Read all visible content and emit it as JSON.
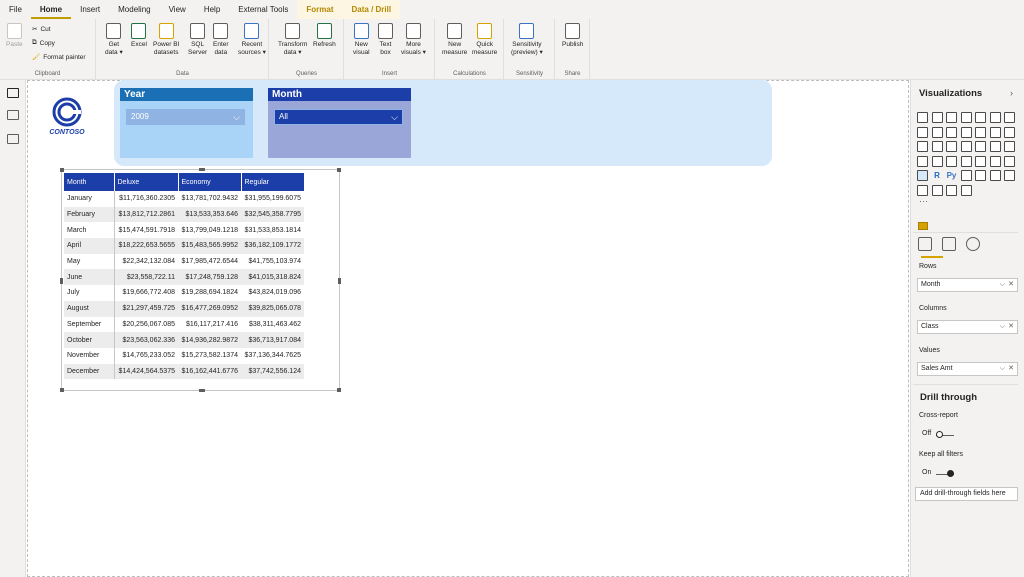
{
  "tabs": [
    "File",
    "Home",
    "Insert",
    "Modeling",
    "View",
    "Help",
    "External Tools",
    "Format",
    "Data / Drill"
  ],
  "ribbon": {
    "clipboard": {
      "paste": "Paste",
      "cut": "Cut",
      "copy": "Copy",
      "format_painter": "Format painter",
      "label": "Clipboard"
    },
    "data": {
      "get_data": [
        "Get",
        "data ▾"
      ],
      "excel": "Excel",
      "power_bi": [
        "Power BI",
        "datasets"
      ],
      "sql": [
        "SQL",
        "Server"
      ],
      "enter": [
        "Enter",
        "data"
      ],
      "recent": [
        "Recent",
        "sources ▾"
      ],
      "label": "Data"
    },
    "queries": {
      "transform": [
        "Transform",
        "data ▾"
      ],
      "refresh": "Refresh",
      "label": "Queries"
    },
    "insert": {
      "new_visual": [
        "New",
        "visual"
      ],
      "text_box": [
        "Text",
        "box"
      ],
      "more_visuals": [
        "More",
        "visuals ▾"
      ],
      "label": "Insert"
    },
    "calculations": {
      "new_measure": [
        "New",
        "measure"
      ],
      "quick_measure": [
        "Quick",
        "measure"
      ],
      "label": "Calculations"
    },
    "sensitivity": {
      "btn": [
        "Sensitivity",
        "(preview) ▾"
      ],
      "label": "Sensitivity"
    },
    "share": {
      "publish": "Publish",
      "label": "Share"
    }
  },
  "logo": {
    "text": "CONTOSO"
  },
  "year_slicer": {
    "title": "Year",
    "value": "2009",
    "chevron": "⌵"
  },
  "month_slicer": {
    "title": "Month",
    "value": "All",
    "chevron": "⌵"
  },
  "table": {
    "headers": [
      "Month",
      "Deluxe",
      "Economy",
      "Regular"
    ],
    "rows": [
      [
        "January",
        "$11,716,360.2305",
        "$13,781,702.9432",
        "$31,955,199.6075"
      ],
      [
        "February",
        "$13,812,712.2861",
        "$13,533,353.646",
        "$32,545,358.7795"
      ],
      [
        "March",
        "$15,474,591.7918",
        "$13,799,049.1218",
        "$31,533,853.1814"
      ],
      [
        "April",
        "$18,222,653.5655",
        "$15,483,565.9952",
        "$36,182,109.1772"
      ],
      [
        "May",
        "$22,342,132.084",
        "$17,985,472.6544",
        "$41,755,103.974"
      ],
      [
        "June",
        "$23,558,722.11",
        "$17,248,759.128",
        "$41,015,318.824"
      ],
      [
        "July",
        "$19,666,772.408",
        "$19,288,694.1824",
        "$43,824,019.096"
      ],
      [
        "August",
        "$21,297,459.725",
        "$16,477,269.0952",
        "$39,825,065.078"
      ],
      [
        "September",
        "$20,256,067.085",
        "$16,117,217.416",
        "$38,311,463.462"
      ],
      [
        "October",
        "$23,563,062.336",
        "$14,936,282.9872",
        "$36,713,917.084"
      ],
      [
        "November",
        "$14,765,233.052",
        "$15,273,582.1374",
        "$37,136,344.7625"
      ],
      [
        "December",
        "$14,424,564.5375",
        "$16,162,441.6776",
        "$37,742,556.124"
      ]
    ]
  },
  "viz_pane": {
    "title": "Visualizations",
    "expand_chevron": "›",
    "python_label": "Py",
    "r_label": "R",
    "more": "···",
    "rows_label": "Rows",
    "rows_value": "Month",
    "columns_label": "Columns",
    "columns_value": "Class",
    "values_label": "Values",
    "values_value": "Sales Amt",
    "well_chevron": "⌵",
    "remove": "✕",
    "drill_title": "Drill through",
    "cross_report_label": "Cross-report",
    "cross_report_state": "Off",
    "keep_filters_label": "Keep all filters",
    "keep_filters_state": "On",
    "add_drill": "Add drill-through fields here"
  },
  "colors": {
    "accent": "#c19c00",
    "table_header": "#1c3ea8",
    "year_header": "#1a6fb5",
    "month_header": "#1c3ea8",
    "banner": "#d6e9fb"
  }
}
